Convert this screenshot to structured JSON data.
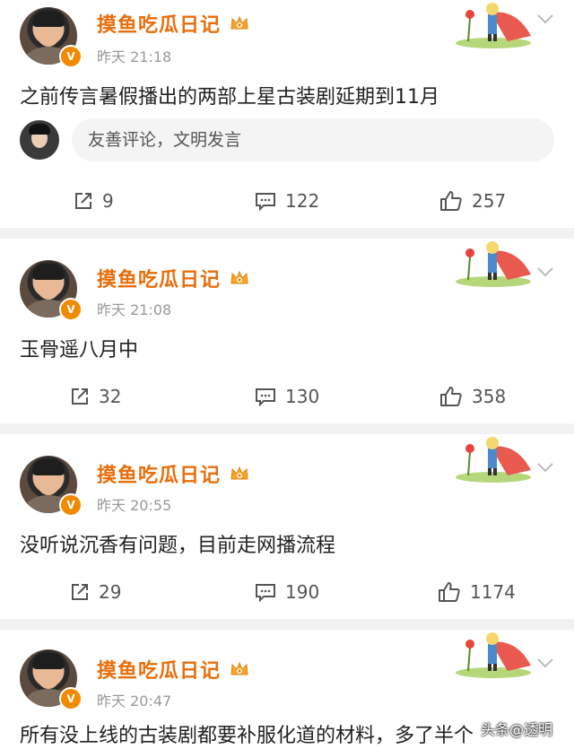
{
  "posts": [
    {
      "username": "摸鱼吃瓜日记",
      "time": "昨天 21:18",
      "content": "之前传言暑假播出的两部上星古装剧延期到11月",
      "comment_placeholder": "友善评论，文明发言",
      "reposts": "9",
      "comments": "122",
      "likes": "257"
    },
    {
      "username": "摸鱼吃瓜日记",
      "time": "昨天 21:08",
      "content": "玉骨遥八月中",
      "reposts": "32",
      "comments": "130",
      "likes": "358"
    },
    {
      "username": "摸鱼吃瓜日记",
      "time": "昨天 20:55",
      "content": "没听说沉香有问题，目前走网播流程",
      "reposts": "29",
      "comments": "190",
      "likes": "1174"
    },
    {
      "username": "摸鱼吃瓜日记",
      "time": "昨天 20:47",
      "content": "所有没上线的古装剧都要补服化道的材料，多了半个"
    }
  ],
  "verified_badge": "V",
  "watermark": "头条@透明",
  "colors": {
    "username": "#ea6d0a",
    "badge": "#f28a00",
    "background": "#f2f2f2"
  },
  "icons": [
    "repost-icon",
    "comment-icon",
    "like-icon",
    "crown-icon",
    "chevron-down-icon",
    "little-prince-decoration"
  ]
}
